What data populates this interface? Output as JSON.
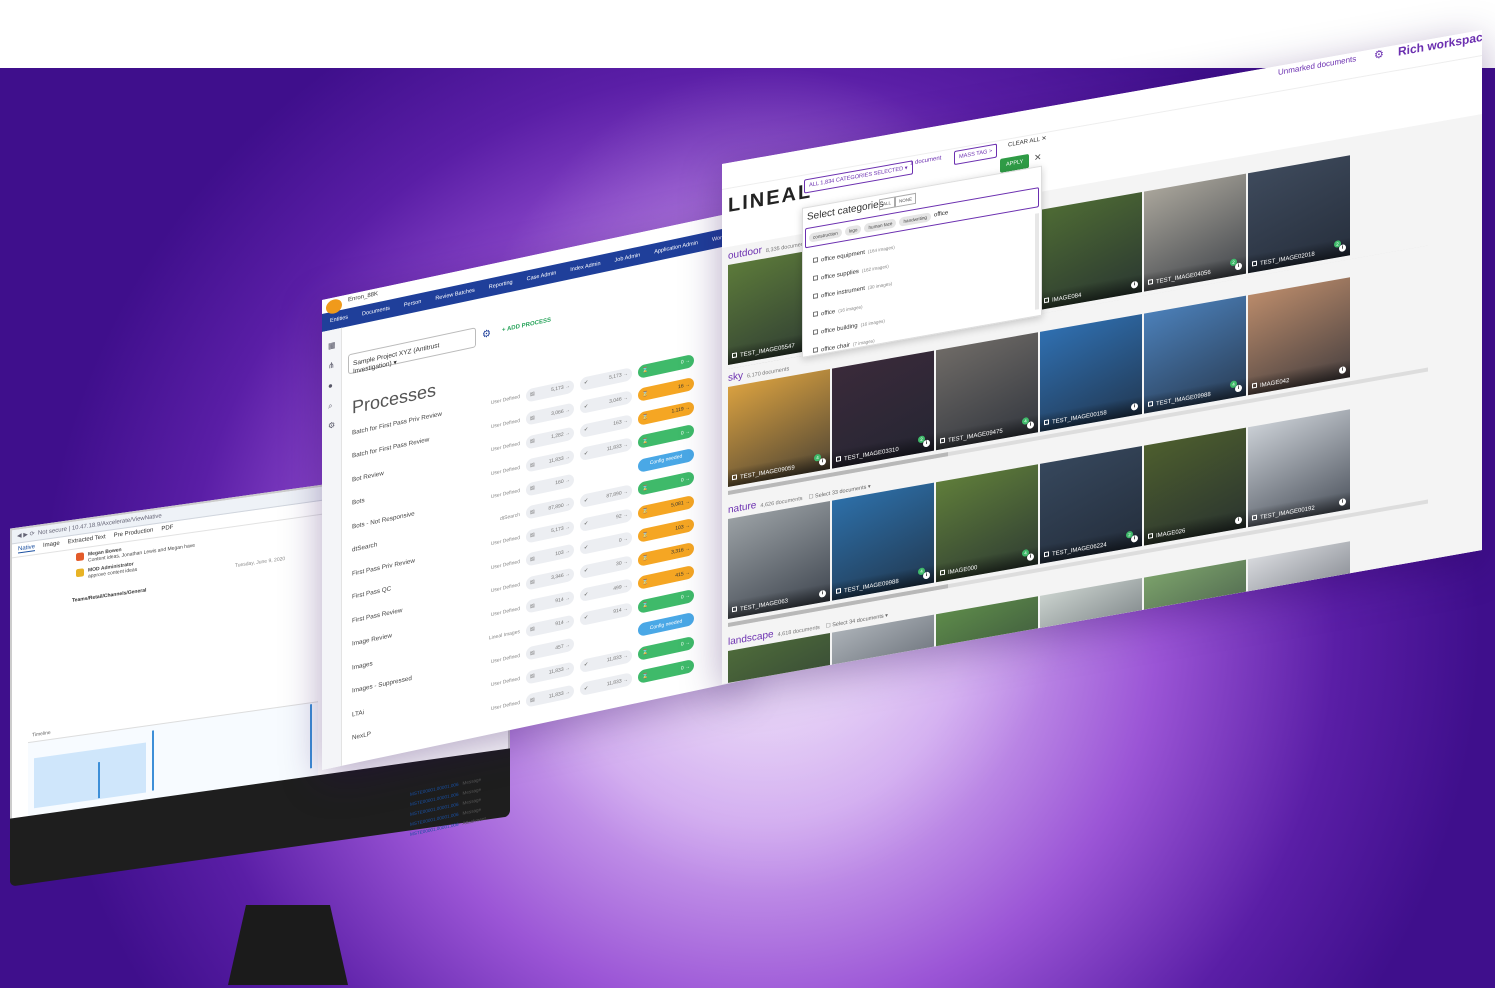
{
  "brand": {
    "accent": "#6b2fb0",
    "navy": "#1f3f9a",
    "green": "#3fba6a",
    "orange": "#f5a623",
    "blue": "#4aa8e6"
  },
  "left_window": {
    "doc_id": "MSTE00001",
    "tabs": [
      "Native",
      "Image",
      "Extracted Text",
      "Pre Production",
      "PDF"
    ],
    "messages": [
      {
        "author": "Megan Bowen",
        "text": "Content ideas, Jonathan Lewis and Megan have"
      },
      {
        "author": "MOD Administrator",
        "text": "approve content ideas"
      }
    ],
    "date_divider": "Tuesday, June 9, 2020",
    "channel": "Teams/Retail/Channels/General",
    "timeline_label": "Timeline",
    "rows": [
      {
        "id": "MSTE00001.00001.006",
        "type": "Message"
      },
      {
        "id": "MSTE00001.00001.006",
        "type": "Message"
      },
      {
        "id": "MSTE00001.00001.006",
        "type": "Message"
      },
      {
        "id": "MSTE00001.00001.006",
        "type": "Message"
      },
      {
        "id": "MSTE00001.00001.006",
        "type": "Attachment"
      }
    ]
  },
  "middle_window": {
    "title": "Enron_88K",
    "nav": [
      "Entities",
      "Documents",
      "Person",
      "Review Batches",
      "Reporting",
      "Case Admin",
      "Index Admin",
      "Job Admin",
      "Application Admin",
      "Workspace Admin"
    ],
    "project": "Sample Project XYZ (Antitrust Investigation)",
    "add_process": "+ ADD PROCESS",
    "heading": "Processes",
    "processes": [
      {
        "name": "Batch for First Pass Priv Review",
        "type": "User Defined",
        "a": "5,173 →",
        "b": "5,173 →",
        "c": "0 →",
        "state": "green"
      },
      {
        "name": "Batch for First Pass Review",
        "type": "User Defined",
        "a": "3,066 →",
        "b": "3,046 →",
        "c": "16 →",
        "state": "orange"
      },
      {
        "name": "Bot Review",
        "type": "User Defined",
        "a": "1,282 →",
        "b": "163 →",
        "c": "1,119 →",
        "state": "orange"
      },
      {
        "name": "Bots",
        "type": "User Defined",
        "a": "11,833 →",
        "b": "11,833 →",
        "c": "0 →",
        "state": "green"
      },
      {
        "name": "Bots - Not Responsive",
        "type": "User Defined",
        "a": "160 →",
        "b": "",
        "c": "Config needed",
        "state": "cfg"
      },
      {
        "name": "dtSearch",
        "type": "dtSearch",
        "a": "87,890 →",
        "b": "87,890 →",
        "c": "0 →",
        "state": "green"
      },
      {
        "name": "First Pass Priv Review",
        "type": "User Defined",
        "a": "5,173 →",
        "b": "92 →",
        "c": "5,081 →",
        "state": "orange"
      },
      {
        "name": "First Pass QC",
        "type": "User Defined",
        "a": "103 →",
        "b": "0 →",
        "c": "103 →",
        "state": "orange"
      },
      {
        "name": "First Pass Review",
        "type": "User Defined",
        "a": "3,346 →",
        "b": "30 →",
        "c": "3,316 →",
        "state": "orange"
      },
      {
        "name": "Image Review",
        "type": "User Defined",
        "a": "914 →",
        "b": "499 →",
        "c": "415 →",
        "state": "orange"
      },
      {
        "name": "Images",
        "type": "Lineal Images",
        "a": "914 →",
        "b": "914 →",
        "c": "0 →",
        "state": "green"
      },
      {
        "name": "Images - Suppressed",
        "type": "User Defined",
        "a": "457 →",
        "b": "",
        "c": "Config needed",
        "state": "cfg"
      },
      {
        "name": "LTAi",
        "type": "User Defined",
        "a": "11,833 →",
        "b": "11,833 →",
        "c": "0 →",
        "state": "green"
      },
      {
        "name": "NexLP",
        "type": "User Defined",
        "a": "11,833 →",
        "b": "11,833 →",
        "c": "0 →",
        "state": "green"
      }
    ]
  },
  "right_window": {
    "logo": "LINEAL",
    "unmarked": "Unmarked documents",
    "workspace": "Rich workspace",
    "categories_dropdown": "ALL 1,834 CATEGORIES SELECTED",
    "doc_count": "1 document",
    "mass_tag": "MASS TAG >",
    "clear_all": "CLEAR ALL ✕",
    "apply": "APPLY",
    "select_categories": "Select categories",
    "all": "ALL",
    "none": "NONE",
    "chips": [
      "construction",
      "logo",
      "human face",
      "handwriting"
    ],
    "query": "office",
    "options": [
      {
        "label": "office equipment",
        "count": "(164 images)"
      },
      {
        "label": "office supplies",
        "count": "(162 images)"
      },
      {
        "label": "office instrument",
        "count": "(30 images)"
      },
      {
        "label": "office",
        "count": "(16 images)"
      },
      {
        "label": "office building",
        "count": "(16 images)"
      },
      {
        "label": "office chair",
        "count": "(7 images)"
      }
    ],
    "sections": [
      {
        "label": "outdoor",
        "count": "8,335 documents",
        "select": "",
        "tiles": [
          {
            "name": "TEST_IMAGE05547",
            "badge": ""
          },
          {
            "name": "",
            "badge": ""
          },
          {
            "name": "",
            "badge": ""
          },
          {
            "name": "IMAGE084",
            "badge": ""
          },
          {
            "name": "TEST_IMAGE04056",
            "badge": "2"
          },
          {
            "name": "TEST_IMAGE02018",
            "badge": "2"
          }
        ]
      },
      {
        "label": "sky",
        "count": "6,170 documents",
        "select": "",
        "tiles": [
          {
            "name": "TEST_IMAGE09059",
            "badge": "4"
          },
          {
            "name": "TEST_IMAGE03310",
            "badge": "2"
          },
          {
            "name": "TEST_IMAGE09475",
            "badge": "4"
          },
          {
            "name": "TEST_IMAGE00158",
            "badge": ""
          },
          {
            "name": "TEST_IMAGE09988",
            "badge": "4"
          },
          {
            "name": "IMAGE042",
            "badge": ""
          }
        ]
      },
      {
        "label": "nature",
        "count": "4,626 documents",
        "select": "Select 33 documents ▾",
        "tiles": [
          {
            "name": "TEST_IMAGE063",
            "badge": ""
          },
          {
            "name": "TEST_IMAGE09988",
            "badge": "4"
          },
          {
            "name": "IMAGE000",
            "badge": "4"
          },
          {
            "name": "TEST_IMAGE06224",
            "badge": "2"
          },
          {
            "name": "IMAGE026",
            "badge": ""
          },
          {
            "name": "TEST_IMAGE00192",
            "badge": ""
          }
        ]
      },
      {
        "label": "landscape",
        "count": "4,618 documents",
        "select": "Select 34 documents ▾",
        "tiles": []
      }
    ]
  }
}
